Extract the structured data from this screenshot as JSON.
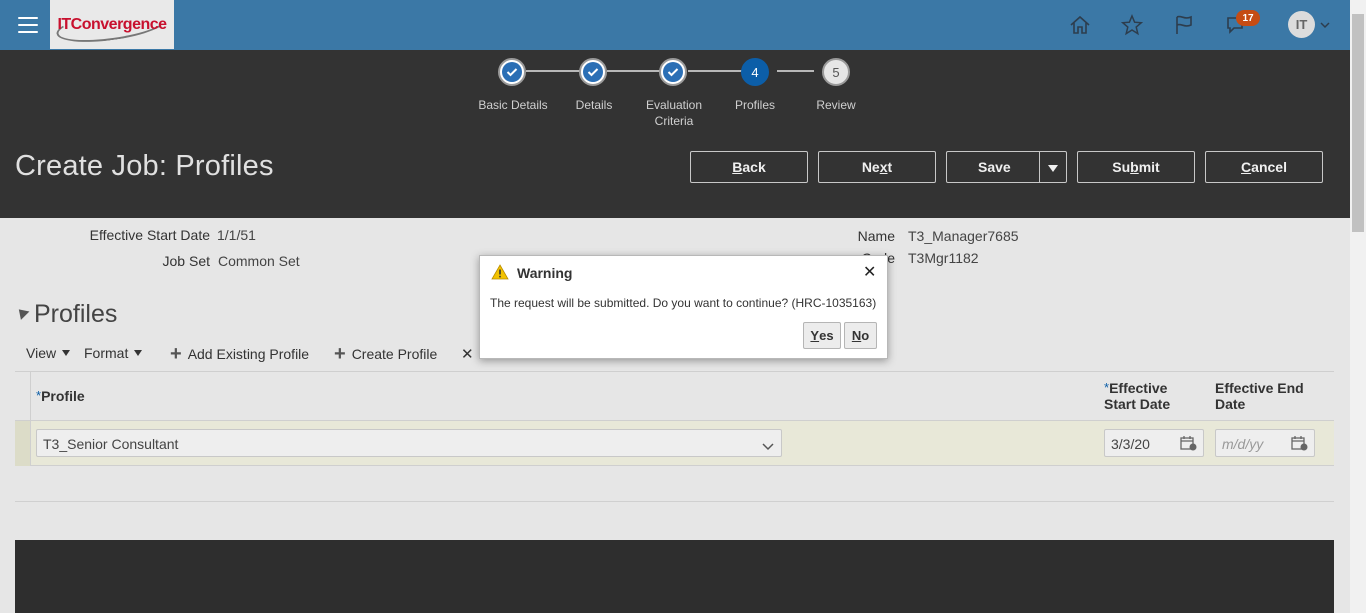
{
  "header": {
    "logo_it": "IT",
    "logo_rest": "Convergence",
    "notification_count": "17",
    "user_initials": "IT",
    "icons": [
      "home-icon",
      "favorites-star-icon",
      "watchlist-flag-icon",
      "notifications-bell-icon"
    ]
  },
  "train": {
    "stops": [
      {
        "label": "Basic Details",
        "number": "1",
        "state": "done"
      },
      {
        "label": "Details",
        "number": "2",
        "state": "done"
      },
      {
        "label_line1": "Evaluation",
        "label_line2": "Criteria",
        "number": "3",
        "state": "done"
      },
      {
        "label": "Profiles",
        "number": "4",
        "state": "current"
      },
      {
        "label": "Review",
        "number": "5",
        "state": "future"
      }
    ]
  },
  "page": {
    "title": "Create Job: Profiles"
  },
  "actions": {
    "back_first": "B",
    "back_rest": "ack",
    "next_pre": "Ne",
    "next_u": "x",
    "next_post": "t",
    "save": "Save",
    "submit_pre": "Su",
    "submit_u": "b",
    "submit_post": "mit",
    "cancel_first": "C",
    "cancel_rest": "ancel"
  },
  "fields": {
    "effective_start_date_label": "Effective Start Date",
    "effective_start_date_value": "1/1/51",
    "job_set_label": "Job Set",
    "job_set_value": "Common Set",
    "name_label": "Name",
    "name_value": "T3_Manager7685",
    "code_label": "Code",
    "code_value": "T3Mgr1182"
  },
  "profiles": {
    "section_title": "Profiles",
    "toolbar": {
      "view": "View",
      "format": "Format",
      "add_existing": "Add Existing Profile",
      "create": "Create Profile",
      "delete_symbol": "✕"
    },
    "columns": {
      "profile": "Profile",
      "eff_start_line1": "Effective",
      "eff_start_line2": "Start Date",
      "eff_end_line1": "Effective End",
      "eff_end_line2": "Date",
      "required_mark": "*"
    },
    "rows": [
      {
        "profile": "T3_Senior Consultant",
        "start_date": "3/3/20",
        "end_date_placeholder": "m/d/yy"
      }
    ]
  },
  "dialog": {
    "title": "Warning",
    "message": "The request will be submitted. Do you want to continue? (HRC-1035163)",
    "yes_first": "Y",
    "yes_rest": "es",
    "no_first": "N",
    "no_rest": "o",
    "close_symbol": "✕"
  }
}
